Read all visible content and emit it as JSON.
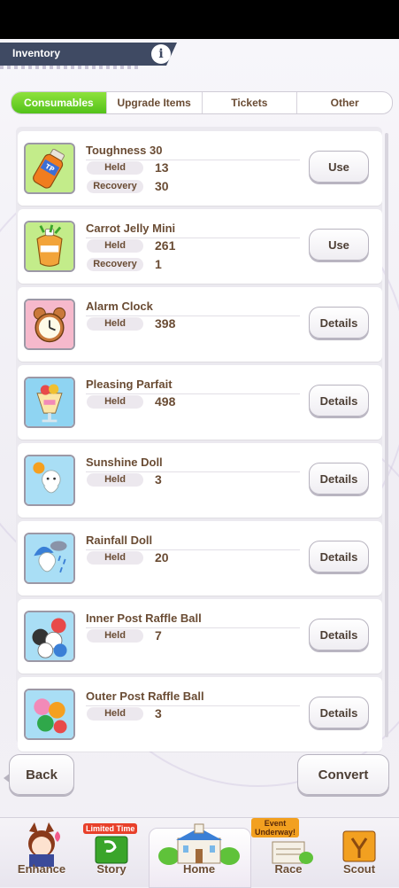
{
  "header": {
    "title": "Inventory",
    "info_label": "i"
  },
  "tabs": [
    {
      "label": "Consumables",
      "active": true
    },
    {
      "label": "Upgrade Items",
      "active": false
    },
    {
      "label": "Tickets",
      "active": false
    },
    {
      "label": "Other",
      "active": false
    }
  ],
  "items": [
    {
      "name": "Toughness 30",
      "held_label": "Held",
      "held": "13",
      "recovery_label": "Recovery",
      "recovery": "30",
      "button": "Use",
      "icon": "drink-bottle-icon"
    },
    {
      "name": "Carrot Jelly Mini",
      "held_label": "Held",
      "held": "261",
      "recovery_label": "Recovery",
      "recovery": "1",
      "button": "Use",
      "icon": "jelly-pouch-icon"
    },
    {
      "name": "Alarm Clock",
      "held_label": "Held",
      "held": "398",
      "button": "Details",
      "icon": "alarm-clock-icon"
    },
    {
      "name": "Pleasing Parfait",
      "held_label": "Held",
      "held": "498",
      "button": "Details",
      "icon": "parfait-icon"
    },
    {
      "name": "Sunshine Doll",
      "held_label": "Held",
      "held": "3",
      "button": "Details",
      "icon": "sunshine-doll-icon"
    },
    {
      "name": "Rainfall Doll",
      "held_label": "Held",
      "held": "20",
      "button": "Details",
      "icon": "rainfall-doll-icon"
    },
    {
      "name": "Inner Post Raffle Ball",
      "held_label": "Held",
      "held": "7",
      "button": "Details",
      "icon": "inner-raffle-balls-icon"
    },
    {
      "name": "Outer Post Raffle Ball",
      "held_label": "Held",
      "held": "3",
      "button": "Details",
      "icon": "outer-raffle-balls-icon"
    }
  ],
  "actions": {
    "back": "Back",
    "convert": "Convert"
  },
  "nav": {
    "enhance": "Enhance",
    "story": "Story",
    "story_badge": "Limited Time",
    "home": "Home",
    "race": "Race",
    "race_badge": "Event Underway!",
    "scout": "Scout"
  },
  "colors": {
    "tab_active": "#53c21a",
    "text_brown": "#6a4c34",
    "header_bg": "#3f4a63"
  }
}
